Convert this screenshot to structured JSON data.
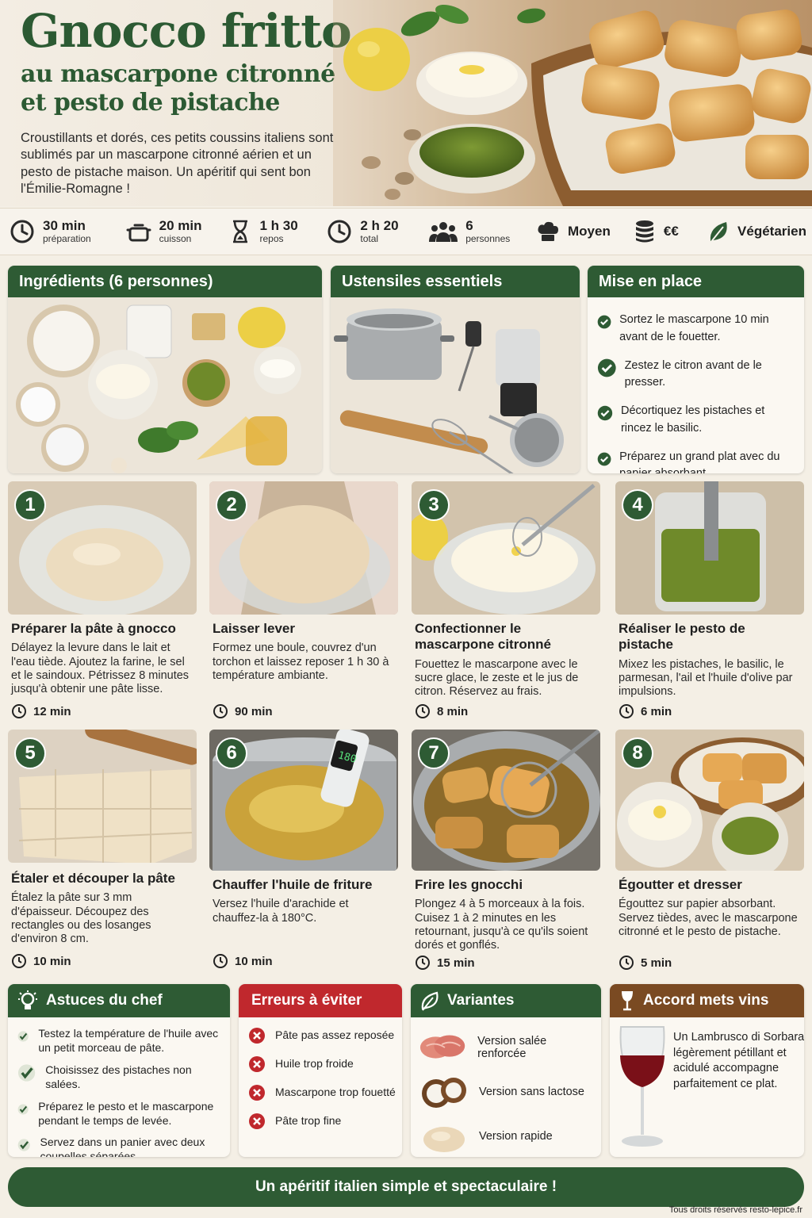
{
  "hero": {
    "title": "Gnocco fritto",
    "subtitle_line1": "au mascarpone citronné",
    "subtitle_line2": "et pesto de pistache",
    "intro": "Croustillants et dorés, ces petits coussins italiens sont sublimés par un mascarpone citronné aérien et un pesto de pistache maison. Un apéritif qui sent bon l'Émilie-Romagne !"
  },
  "info": [
    {
      "icon": "clock-icon",
      "value": "30 min",
      "sub": "préparation"
    },
    {
      "icon": "pot-icon",
      "value": "20 min",
      "sub": "cuisson"
    },
    {
      "icon": "hourglass-icon",
      "value": "1 h 30",
      "sub": "repos"
    },
    {
      "icon": "clock-icon",
      "value": "2 h 20",
      "sub": "total"
    },
    {
      "icon": "people-icon",
      "value": "6",
      "sub": "personnes"
    },
    {
      "icon": "chef-hat-icon",
      "value": "Moyen",
      "sub": ""
    },
    {
      "icon": "coins-icon",
      "value": "€€",
      "sub": ""
    },
    {
      "icon": "leaf-icon",
      "value": "Végétarien",
      "sub": ""
    }
  ],
  "cards": {
    "ingredients_title": "Ingrédients (6 personnes)",
    "tools_title": "Ustensiles essentiels",
    "mep_title": "Mise en place",
    "mep_items": [
      "Sortez le mascarpone 10 min avant de le fouetter.",
      "Zestez le citron avant de le presser.",
      "Décortiquez les pistaches et rincez le basilic.",
      "Préparez un grand plat avec du papier absorbant."
    ]
  },
  "steps": [
    {
      "num": "1",
      "title": "Préparer la pâte à gnocco",
      "desc": "Délayez la levure dans le lait et l'eau tiède. Ajoutez la farine, le sel et le saindoux. Pétrissez 8 minutes jusqu'à obtenir une pâte lisse.",
      "time": "12 min"
    },
    {
      "num": "2",
      "title": "Laisser lever",
      "desc": "Formez une boule, couvrez d'un torchon et laissez reposer 1 h 30 à température ambiante.",
      "time": "90 min"
    },
    {
      "num": "3",
      "title": "Confectionner le mascarpone citronné",
      "desc": "Fouettez le mascarpone avec le sucre glace, le zeste et le jus de citron. Réservez au frais.",
      "time": "8 min"
    },
    {
      "num": "4",
      "title": "Réaliser le pesto de pistache",
      "desc": "Mixez les pistaches, le basilic, le parmesan, l'ail et l'huile d'olive par impulsions.",
      "time": "6 min"
    },
    {
      "num": "5",
      "title": "Étaler et découper la pâte",
      "desc": "Étalez la pâte sur 3 mm d'épaisseur. Découpez des rectangles ou des losanges d'environ 8 cm.",
      "time": "10 min"
    },
    {
      "num": "6",
      "title": "Chauffer l'huile de friture",
      "desc": "Versez l'huile d'arachide et chauffez-la à 180°C.",
      "time": "10 min",
      "thermo": "180"
    },
    {
      "num": "7",
      "title": "Frire les gnocchi",
      "desc": "Plongez 4 à 5 morceaux à la fois. Cuisez 1 à 2 minutes en les retournant, jusqu'à ce qu'ils soient dorés et gonflés.",
      "time": "15 min"
    },
    {
      "num": "8",
      "title": "Égoutter et dresser",
      "desc": "Égouttez sur papier absorbant. Servez tièdes, avec le mascarpone citronné et le pesto de pistache.",
      "time": "5 min"
    }
  ],
  "tips": {
    "title": "Astuces du chef",
    "items": [
      "Testez la température de l'huile avec un petit morceau de pâte.",
      "Choisissez des pistaches non salées.",
      "Préparez le pesto et le mascarpone pendant le temps de levée.",
      "Servez dans un panier avec deux coupelles séparées."
    ]
  },
  "errors": {
    "title": "Erreurs à éviter",
    "items": [
      "Pâte pas assez reposée",
      "Huile trop froide",
      "Mascarpone trop fouetté",
      "Pâte trop fine"
    ]
  },
  "variants": {
    "title": "Variantes",
    "items": [
      "Version salée renforcée",
      "Version sans lactose",
      "Version rapide"
    ]
  },
  "wine": {
    "title": "Accord mets vins",
    "text": "Un Lambrusco di Sorbara légèrement pétillant et acidulé accompagne parfaitement ce plat."
  },
  "footer": {
    "banner": "Un apéritif italien simple et spectaculaire !",
    "copyright": "Tous droits réservés resto-lepice.fr"
  },
  "colors": {
    "green": "#2e5b34",
    "red": "#c0282d",
    "brown": "#7a4a22",
    "cream": "#f4efe5"
  }
}
